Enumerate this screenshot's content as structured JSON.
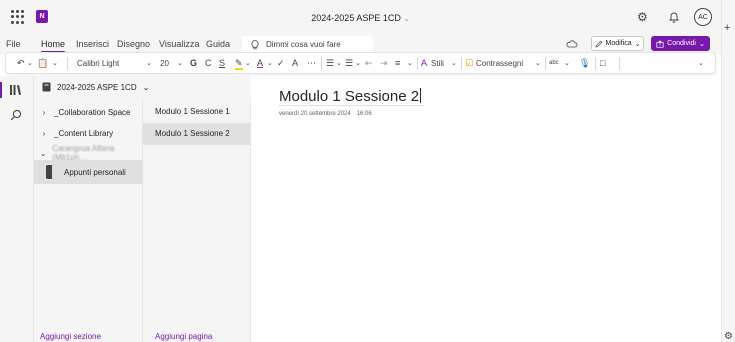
{
  "titlebar": {
    "app_logo": "N",
    "doc_title": "2024-2025 ASPE 1CD",
    "avatar": "AC"
  },
  "menubar": {
    "items": [
      "File",
      "Home",
      "Inserisci",
      "Disegno",
      "Visualizza",
      "Guida"
    ],
    "active": "Home",
    "tell_me_placeholder": "Dimmi cosa vuoi fare",
    "modifica_label": "Modifica",
    "condividi_label": "Condividi"
  },
  "ribbon": {
    "font_name": "Calibri Light",
    "font_size": "20",
    "bold": "G",
    "italic": "C",
    "underline": "S",
    "stili_label": "Stili",
    "contrassegni_label": "Contrassegni",
    "spell_label": "abc"
  },
  "notebook": {
    "name": "2024-2025 ASPE 1CD"
  },
  "sections": {
    "items": [
      {
        "label": "_Collaboration Space"
      },
      {
        "label": "_Content Library"
      },
      {
        "label": "Carangrua Alfana (Mb1ph…"
      }
    ],
    "personal": "Appunti personali",
    "add_label": "Aggiungi sezione"
  },
  "pages": {
    "items": [
      {
        "label": "Modulo 1 Sessione 1"
      },
      {
        "label": "Modulo 1 Sessione 2"
      }
    ],
    "selected_index": 1,
    "add_label": "Aggiungi pagina"
  },
  "page": {
    "title": "Modulo 1 Sessione 2",
    "date": "venerdì 20 settembre 2024",
    "time": "16:06"
  },
  "colors": {
    "accent": "#7719aa",
    "chrome": "#f5f5f5",
    "selection": "#e0e0e0"
  }
}
